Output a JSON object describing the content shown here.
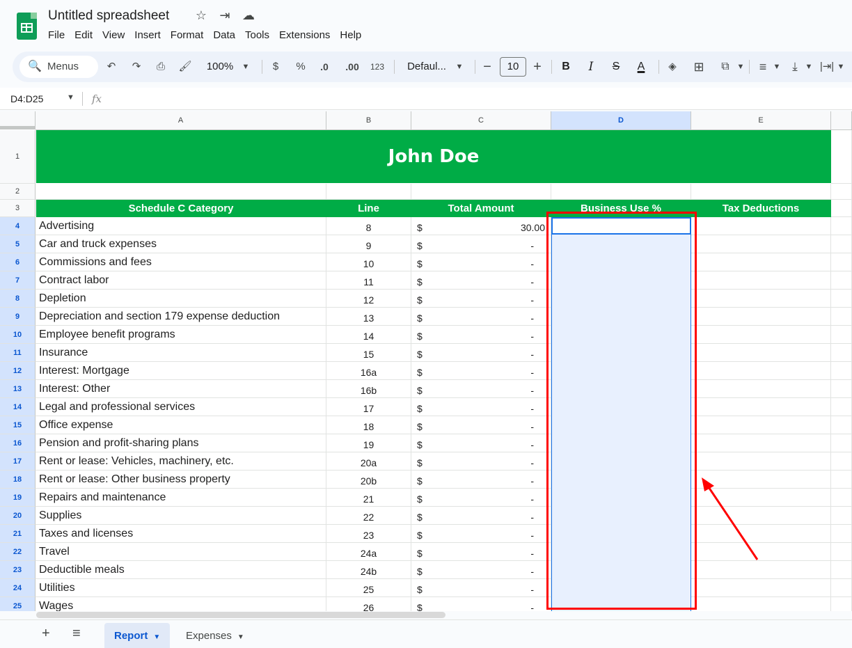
{
  "title": "Untitled spreadsheet",
  "title_icons": [
    "star-icon",
    "move-folder-icon",
    "cloud-status-icon"
  ],
  "menu": [
    "File",
    "Edit",
    "View",
    "Insert",
    "Format",
    "Data",
    "Tools",
    "Extensions",
    "Help"
  ],
  "toolbar": {
    "search_label": "Menus",
    "zoom": "100%",
    "currency": "$",
    "percent": "%",
    "dec_decrease": ".0",
    "dec_increase": ".00",
    "format_number": "123",
    "font": "Defaul...",
    "font_size": "10",
    "bold": "B",
    "italic": "I",
    "strike": "S",
    "text_color": "A"
  },
  "namebox": "D4:D25",
  "fx": "fx",
  "columns": [
    {
      "label": "A"
    },
    {
      "label": "B"
    },
    {
      "label": "C"
    },
    {
      "label": "D",
      "selected": true
    },
    {
      "label": "E"
    }
  ],
  "banner": "John Doe",
  "headers": [
    "Schedule C Category",
    "Line",
    "Total Amount",
    "Business Use %",
    "Tax Deductions"
  ],
  "rows": [
    {
      "num": "4",
      "category": "Advertising",
      "line": "8",
      "cur": "$",
      "amount": "30.00"
    },
    {
      "num": "5",
      "category": "Car and truck expenses",
      "line": "9",
      "cur": "$",
      "amount": "-"
    },
    {
      "num": "6",
      "category": "Commissions and fees",
      "line": "10",
      "cur": "$",
      "amount": "-"
    },
    {
      "num": "7",
      "category": "Contract labor",
      "line": "11",
      "cur": "$",
      "amount": "-"
    },
    {
      "num": "8",
      "category": "Depletion",
      "line": "12",
      "cur": "$",
      "amount": "-"
    },
    {
      "num": "9",
      "category": "Depreciation and section 179 expense deduction",
      "line": "13",
      "cur": "$",
      "amount": "-"
    },
    {
      "num": "10",
      "category": "Employee benefit programs",
      "line": "14",
      "cur": "$",
      "amount": "-"
    },
    {
      "num": "11",
      "category": "Insurance",
      "line": "15",
      "cur": "$",
      "amount": "-"
    },
    {
      "num": "12",
      "category": "Interest: Mortgage",
      "line": "16a",
      "cur": "$",
      "amount": "-"
    },
    {
      "num": "13",
      "category": "Interest: Other",
      "line": "16b",
      "cur": "$",
      "amount": "-"
    },
    {
      "num": "14",
      "category": "Legal and professional services",
      "line": "17",
      "cur": "$",
      "amount": "-"
    },
    {
      "num": "15",
      "category": "Office expense",
      "line": "18",
      "cur": "$",
      "amount": "-"
    },
    {
      "num": "16",
      "category": "Pension and profit-sharing plans",
      "line": "19",
      "cur": "$",
      "amount": "-"
    },
    {
      "num": "17",
      "category": "Rent or lease: Vehicles, machinery, etc.",
      "line": "20a",
      "cur": "$",
      "amount": "-"
    },
    {
      "num": "18",
      "category": "Rent or lease: Other business property",
      "line": "20b",
      "cur": "$",
      "amount": "-"
    },
    {
      "num": "19",
      "category": "Repairs and maintenance",
      "line": "21",
      "cur": "$",
      "amount": "-"
    },
    {
      "num": "20",
      "category": "Supplies",
      "line": "22",
      "cur": "$",
      "amount": "-"
    },
    {
      "num": "21",
      "category": "Taxes and licenses",
      "line": "23",
      "cur": "$",
      "amount": "-"
    },
    {
      "num": "22",
      "category": "Travel",
      "line": "24a",
      "cur": "$",
      "amount": "-"
    },
    {
      "num": "23",
      "category": "Deductible meals",
      "line": "24b",
      "cur": "$",
      "amount": "-"
    },
    {
      "num": "24",
      "category": "Utilities",
      "line": "25",
      "cur": "$",
      "amount": "-"
    },
    {
      "num": "25",
      "category": "Wages",
      "line": "26",
      "cur": "$",
      "amount": "-"
    }
  ],
  "tabs": [
    {
      "label": "Report",
      "active": true
    },
    {
      "label": "Expenses",
      "active": false
    }
  ],
  "colors": {
    "banner_green": "#00ac46",
    "selection_blue": "#1a73e8",
    "annotation_red": "#ff0000"
  }
}
